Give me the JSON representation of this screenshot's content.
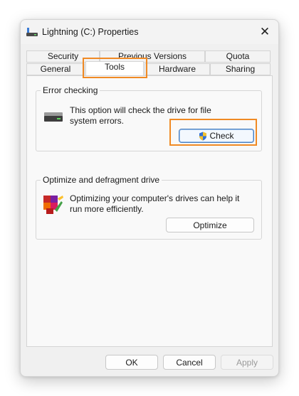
{
  "window": {
    "title": "Lightning (C:) Properties",
    "close_glyph": "✕"
  },
  "tabs_row1": [
    {
      "label": "Security"
    },
    {
      "label": "Previous Versions"
    },
    {
      "label": "Quota"
    }
  ],
  "tabs_row2": [
    {
      "label": "General"
    },
    {
      "label": "Tools",
      "active": true
    },
    {
      "label": "Hardware"
    },
    {
      "label": "Sharing"
    }
  ],
  "error_checking": {
    "label": "Error checking",
    "description": "This option will check the drive for file system errors.",
    "button": "Check",
    "icon": "hard-drive-icon"
  },
  "optimize": {
    "label": "Optimize and defragment drive",
    "description": "Optimizing your computer's drives can help it run more efficiently.",
    "button": "Optimize",
    "icon": "defrag-icon"
  },
  "footer": {
    "ok": "OK",
    "cancel": "Cancel",
    "apply": "Apply"
  },
  "colors": {
    "highlight": "#f08a24",
    "accent": "#4a7fc1"
  }
}
